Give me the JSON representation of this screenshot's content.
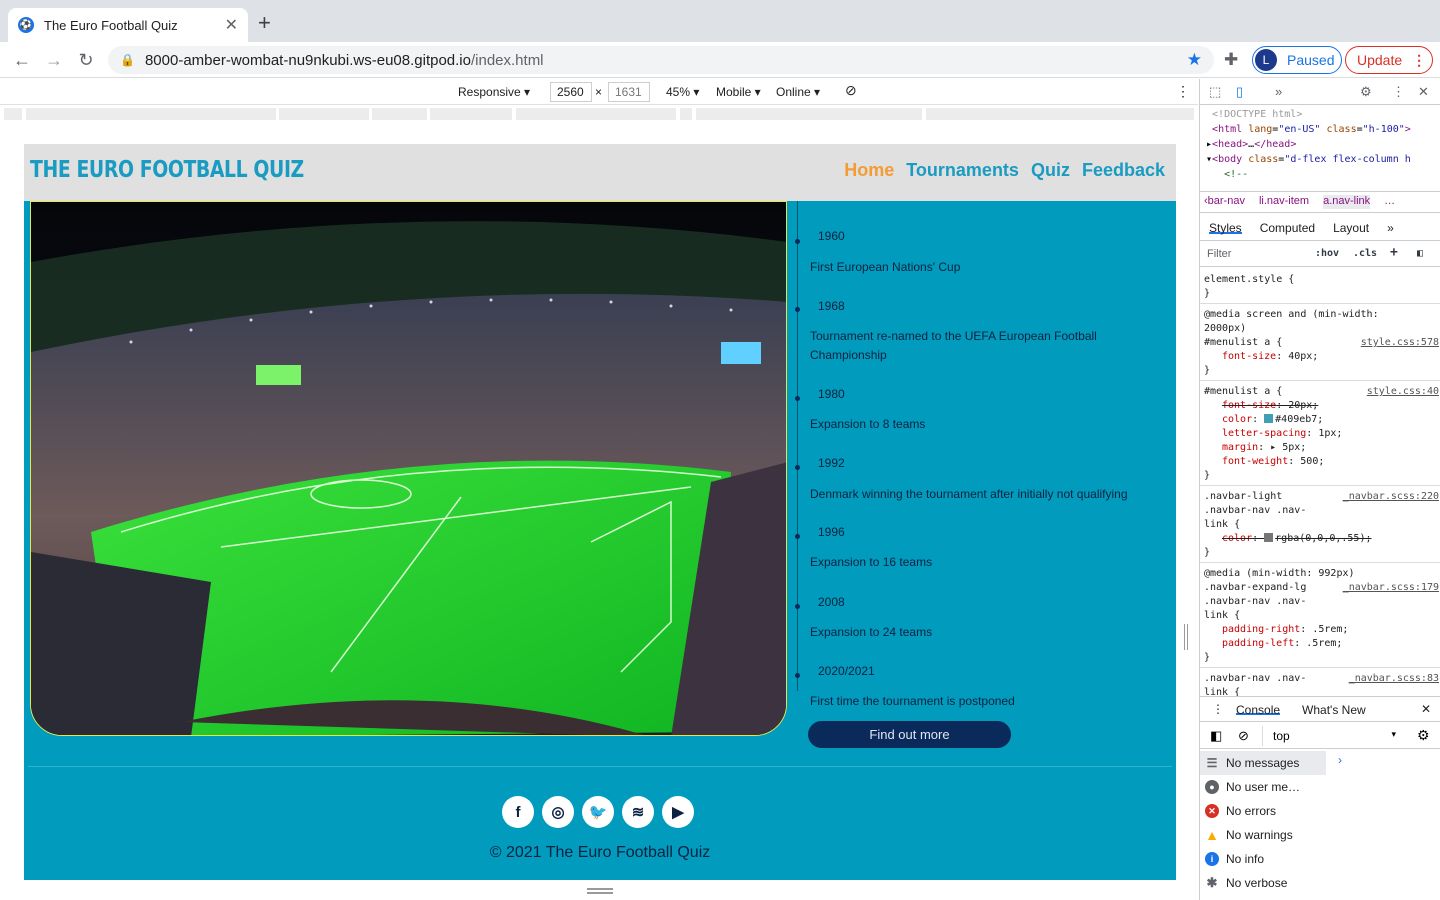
{
  "browser": {
    "tab_title": "The Euro Football Quiz",
    "url_host": "8000-amber-wombat-nu9nkubi.ws-eu08.gitpod.io",
    "url_path": "/index.html",
    "profile_initial": "L",
    "profile_label": "Paused",
    "update_label": "Update"
  },
  "device_toolbar": {
    "mode": "Responsive ▾",
    "width": "2560",
    "height": "1631",
    "zoom": "45% ▾",
    "device": "Mobile ▾",
    "network": "Online ▾"
  },
  "site": {
    "logo": "THE EURO FOOTBALL QUIZ",
    "nav": [
      "Home",
      "Tournaments",
      "Quiz",
      "Feedback"
    ],
    "timeline": [
      {
        "year": "1960",
        "text": "First European Nations' Cup"
      },
      {
        "year": "1968",
        "text": "Tournament re-named to the UEFA European Football Championship"
      },
      {
        "year": "1980",
        "text": "Expansion to 8 teams"
      },
      {
        "year": "1992",
        "text": "Denmark winning the tournament after initially not qualifying"
      },
      {
        "year": "1996",
        "text": "Expansion to 16 teams"
      },
      {
        "year": "2008",
        "text": "Expansion to 24 teams"
      },
      {
        "year": "2020/2021",
        "text": "First time the tournament is postponed"
      }
    ],
    "cta": "Find out more",
    "social": [
      "facebook-icon",
      "instagram-icon",
      "twitter-icon",
      "spotify-icon",
      "youtube-icon"
    ],
    "copyright": "© 2021 The Euro Football Quiz",
    "colors": {
      "background": "#009bbd",
      "nav_link": "#409eb7",
      "nav_active": "#f39c33",
      "cta": "#0a2a5c"
    }
  },
  "devtools": {
    "crumbs": [
      "‹bar-nav",
      "li.nav-item",
      "a.nav-link",
      "…"
    ],
    "tabs": [
      "Styles",
      "Computed",
      "Layout",
      "»"
    ],
    "filter_placeholder": "Filter",
    "hov": ":hov",
    "cls": ".cls",
    "console_tabs": [
      "Console",
      "What's New"
    ],
    "context": "top",
    "messages": [
      "No messages",
      "No user me…",
      "No errors",
      "No warnings",
      "No info",
      "No verbose"
    ]
  }
}
